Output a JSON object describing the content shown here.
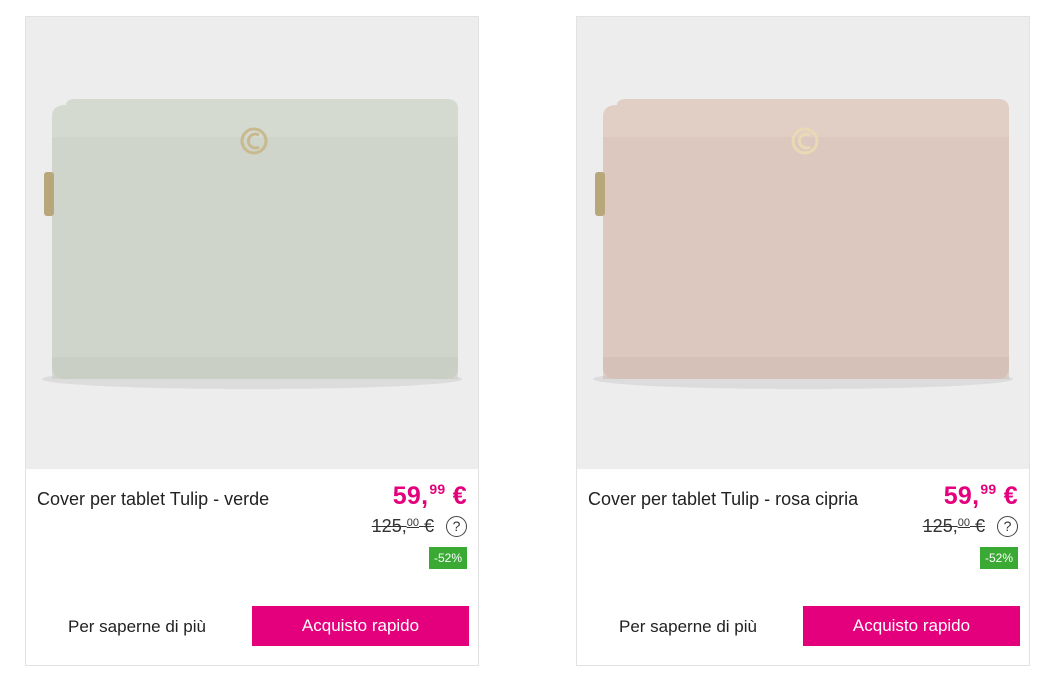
{
  "colors": {
    "accent": "#e4007c",
    "discount_badge": "#3aaa35",
    "image_background": "#ededed"
  },
  "products": [
    {
      "image_alt": "sleeve-green",
      "bag_color": "#cfd5cb",
      "title": "Cover per tablet Tulip - verde",
      "price_int": "59,",
      "price_dec": "99",
      "price_currency": "€",
      "old_price_int": "125,",
      "old_price_dec": "00",
      "old_price_currency": "€",
      "help_icon": "?",
      "discount": "-52%",
      "more_link": "Per saperne di più",
      "quick_buy": "Acquisto rapido"
    },
    {
      "image_alt": "sleeve-pink",
      "bag_color": "#dcc8bf",
      "title": "Cover per tablet Tulip - rosa cipria",
      "price_int": "59,",
      "price_dec": "99",
      "price_currency": "€",
      "old_price_int": "125,",
      "old_price_dec": "00",
      "old_price_currency": "€",
      "help_icon": "?",
      "discount": "-52%",
      "more_link": "Per saperne di più",
      "quick_buy": "Acquisto rapido"
    }
  ]
}
